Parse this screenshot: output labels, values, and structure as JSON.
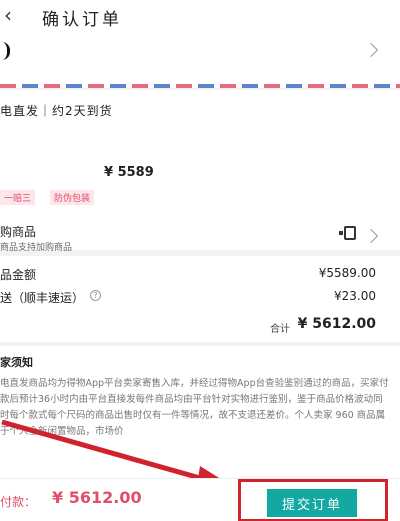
{
  "header": {
    "title": "确认订单",
    "back_icon": "chevron-left-icon"
  },
  "address": {
    "chevron_icon": "chevron-right-icon"
  },
  "product": {
    "shipping_method": "电直发｜约2天到货",
    "price": "¥ 5589",
    "tags": [
      "一赔三",
      "防伪包装"
    ]
  },
  "addon": {
    "title": "购商品",
    "subtitle": "商品支持加购商品",
    "icon": "phone-icon"
  },
  "fees": {
    "items": [
      {
        "label": "品金额",
        "value": "¥5589.00"
      },
      {
        "label": "送（顺丰速运）",
        "value": "¥23.00"
      }
    ],
    "total_label": "合计",
    "total_value": "¥ 5612.00"
  },
  "notice": {
    "title": "家须知",
    "text": "电直发商品均为得物App平台卖家寄售入库，并经过得物App台查验鉴别通过的商品，买家付款后预计36小时内由平台直接发每件商品均由平台针对实物进行鉴别，鉴于商品价格波动同时每个款式每个尺码的商品出售时仅有一件等情况，故不支退还差价。个人卖家 960 商品属于个人全新闲置物品，市场价"
  },
  "bottom": {
    "pay_label": "付款：",
    "pay_amount": "¥ 5612.00",
    "submit_label": "提交订单"
  },
  "colors": {
    "accent_teal": "#14a8a3",
    "price_red": "#e04e6a",
    "annotation_red": "#d0232e"
  }
}
